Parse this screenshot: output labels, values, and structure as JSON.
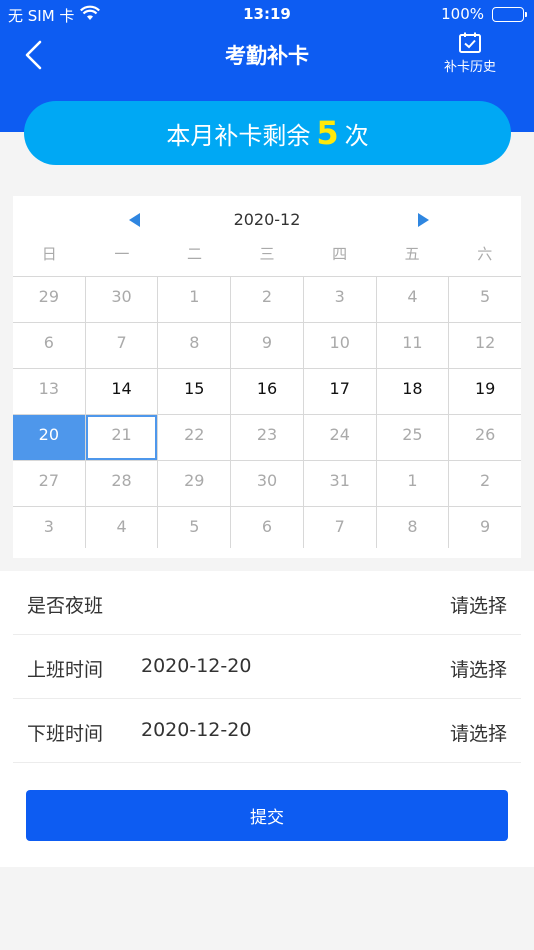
{
  "status_bar": {
    "carrier": "无 SIM 卡",
    "time": "13:19",
    "battery": "100%"
  },
  "header": {
    "title": "考勤补卡",
    "history_label": "补卡历史"
  },
  "quota": {
    "prefix": "本月补卡剩余",
    "count": "5",
    "suffix": "次"
  },
  "calendar": {
    "month": "2020-12",
    "weekdays": [
      "日",
      "一",
      "二",
      "三",
      "四",
      "五",
      "六"
    ],
    "days": [
      "29",
      "30",
      "1",
      "2",
      "3",
      "4",
      "5",
      "6",
      "7",
      "8",
      "9",
      "10",
      "11",
      "12",
      "13",
      "14",
      "15",
      "16",
      "17",
      "18",
      "19",
      "20",
      "21",
      "22",
      "23",
      "24",
      "25",
      "26",
      "27",
      "28",
      "29",
      "30",
      "31",
      "1",
      "2",
      "3",
      "4",
      "5",
      "6",
      "7",
      "8",
      "9"
    ],
    "active_days": [
      "14",
      "15",
      "16",
      "17",
      "18",
      "19"
    ],
    "selected_day": "20",
    "today": "21",
    "accent_color": "#4e97eb"
  },
  "form": {
    "night_shift": {
      "label": "是否夜班",
      "placeholder": "请选择"
    },
    "start_time": {
      "label": "上班时间",
      "date": "2020-12-20",
      "placeholder": "请选择"
    },
    "end_time": {
      "label": "下班时间",
      "date": "2020-12-20",
      "placeholder": "请选择"
    }
  },
  "submit_label": "提交",
  "colors": {
    "primary": "#0d5cf2",
    "quota_bg": "#00a8f4",
    "quota_count": "#ffe90a"
  }
}
